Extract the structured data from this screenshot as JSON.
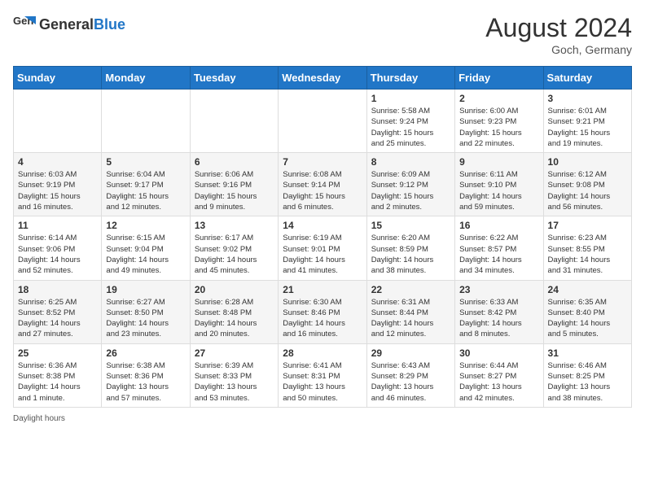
{
  "header": {
    "logo_general": "General",
    "logo_blue": "Blue",
    "month_year": "August 2024",
    "location": "Goch, Germany"
  },
  "days_of_week": [
    "Sunday",
    "Monday",
    "Tuesday",
    "Wednesday",
    "Thursday",
    "Friday",
    "Saturday"
  ],
  "weeks": [
    [
      {
        "day": "",
        "info": ""
      },
      {
        "day": "",
        "info": ""
      },
      {
        "day": "",
        "info": ""
      },
      {
        "day": "",
        "info": ""
      },
      {
        "day": "1",
        "info": "Sunrise: 5:58 AM\nSunset: 9:24 PM\nDaylight: 15 hours\nand 25 minutes."
      },
      {
        "day": "2",
        "info": "Sunrise: 6:00 AM\nSunset: 9:23 PM\nDaylight: 15 hours\nand 22 minutes."
      },
      {
        "day": "3",
        "info": "Sunrise: 6:01 AM\nSunset: 9:21 PM\nDaylight: 15 hours\nand 19 minutes."
      }
    ],
    [
      {
        "day": "4",
        "info": "Sunrise: 6:03 AM\nSunset: 9:19 PM\nDaylight: 15 hours\nand 16 minutes."
      },
      {
        "day": "5",
        "info": "Sunrise: 6:04 AM\nSunset: 9:17 PM\nDaylight: 15 hours\nand 12 minutes."
      },
      {
        "day": "6",
        "info": "Sunrise: 6:06 AM\nSunset: 9:16 PM\nDaylight: 15 hours\nand 9 minutes."
      },
      {
        "day": "7",
        "info": "Sunrise: 6:08 AM\nSunset: 9:14 PM\nDaylight: 15 hours\nand 6 minutes."
      },
      {
        "day": "8",
        "info": "Sunrise: 6:09 AM\nSunset: 9:12 PM\nDaylight: 15 hours\nand 2 minutes."
      },
      {
        "day": "9",
        "info": "Sunrise: 6:11 AM\nSunset: 9:10 PM\nDaylight: 14 hours\nand 59 minutes."
      },
      {
        "day": "10",
        "info": "Sunrise: 6:12 AM\nSunset: 9:08 PM\nDaylight: 14 hours\nand 56 minutes."
      }
    ],
    [
      {
        "day": "11",
        "info": "Sunrise: 6:14 AM\nSunset: 9:06 PM\nDaylight: 14 hours\nand 52 minutes."
      },
      {
        "day": "12",
        "info": "Sunrise: 6:15 AM\nSunset: 9:04 PM\nDaylight: 14 hours\nand 49 minutes."
      },
      {
        "day": "13",
        "info": "Sunrise: 6:17 AM\nSunset: 9:02 PM\nDaylight: 14 hours\nand 45 minutes."
      },
      {
        "day": "14",
        "info": "Sunrise: 6:19 AM\nSunset: 9:01 PM\nDaylight: 14 hours\nand 41 minutes."
      },
      {
        "day": "15",
        "info": "Sunrise: 6:20 AM\nSunset: 8:59 PM\nDaylight: 14 hours\nand 38 minutes."
      },
      {
        "day": "16",
        "info": "Sunrise: 6:22 AM\nSunset: 8:57 PM\nDaylight: 14 hours\nand 34 minutes."
      },
      {
        "day": "17",
        "info": "Sunrise: 6:23 AM\nSunset: 8:55 PM\nDaylight: 14 hours\nand 31 minutes."
      }
    ],
    [
      {
        "day": "18",
        "info": "Sunrise: 6:25 AM\nSunset: 8:52 PM\nDaylight: 14 hours\nand 27 minutes."
      },
      {
        "day": "19",
        "info": "Sunrise: 6:27 AM\nSunset: 8:50 PM\nDaylight: 14 hours\nand 23 minutes."
      },
      {
        "day": "20",
        "info": "Sunrise: 6:28 AM\nSunset: 8:48 PM\nDaylight: 14 hours\nand 20 minutes."
      },
      {
        "day": "21",
        "info": "Sunrise: 6:30 AM\nSunset: 8:46 PM\nDaylight: 14 hours\nand 16 minutes."
      },
      {
        "day": "22",
        "info": "Sunrise: 6:31 AM\nSunset: 8:44 PM\nDaylight: 14 hours\nand 12 minutes."
      },
      {
        "day": "23",
        "info": "Sunrise: 6:33 AM\nSunset: 8:42 PM\nDaylight: 14 hours\nand 8 minutes."
      },
      {
        "day": "24",
        "info": "Sunrise: 6:35 AM\nSunset: 8:40 PM\nDaylight: 14 hours\nand 5 minutes."
      }
    ],
    [
      {
        "day": "25",
        "info": "Sunrise: 6:36 AM\nSunset: 8:38 PM\nDaylight: 14 hours\nand 1 minute."
      },
      {
        "day": "26",
        "info": "Sunrise: 6:38 AM\nSunset: 8:36 PM\nDaylight: 13 hours\nand 57 minutes."
      },
      {
        "day": "27",
        "info": "Sunrise: 6:39 AM\nSunset: 8:33 PM\nDaylight: 13 hours\nand 53 minutes."
      },
      {
        "day": "28",
        "info": "Sunrise: 6:41 AM\nSunset: 8:31 PM\nDaylight: 13 hours\nand 50 minutes."
      },
      {
        "day": "29",
        "info": "Sunrise: 6:43 AM\nSunset: 8:29 PM\nDaylight: 13 hours\nand 46 minutes."
      },
      {
        "day": "30",
        "info": "Sunrise: 6:44 AM\nSunset: 8:27 PM\nDaylight: 13 hours\nand 42 minutes."
      },
      {
        "day": "31",
        "info": "Sunrise: 6:46 AM\nSunset: 8:25 PM\nDaylight: 13 hours\nand 38 minutes."
      }
    ]
  ],
  "footer": {
    "daylight_label": "Daylight hours"
  }
}
